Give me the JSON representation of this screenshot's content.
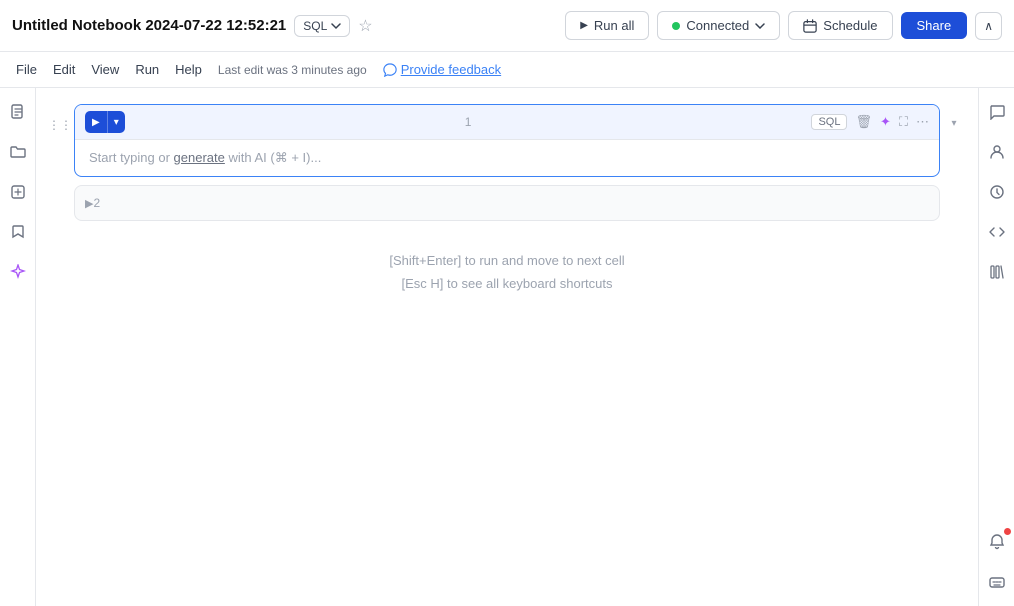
{
  "header": {
    "title": "Untitled Notebook 2024-07-22 12:52:21",
    "sql_label": "SQL",
    "run_all_label": "Run all",
    "connected_label": "Connected",
    "schedule_label": "Schedule",
    "share_label": "Share",
    "last_edit": "Last edit was 3 minutes ago",
    "provide_feedback": "Provide feedback"
  },
  "menu": {
    "file": "File",
    "edit": "Edit",
    "view": "View",
    "run": "Run",
    "help": "Help"
  },
  "cells": [
    {
      "number": "1",
      "type": "SQL",
      "placeholder": "Start typing or generate with AI (⌘ + I)...",
      "generate_link_word": "generate",
      "active": true
    },
    {
      "number": "2",
      "active": false
    }
  ],
  "hints": {
    "line1": "[Shift+Enter] to run and move to next cell",
    "line2": "[Esc H] to see all keyboard shortcuts"
  },
  "sidebar": {
    "icons": [
      "document",
      "folder",
      "package",
      "bookmark",
      "sparkle"
    ]
  }
}
